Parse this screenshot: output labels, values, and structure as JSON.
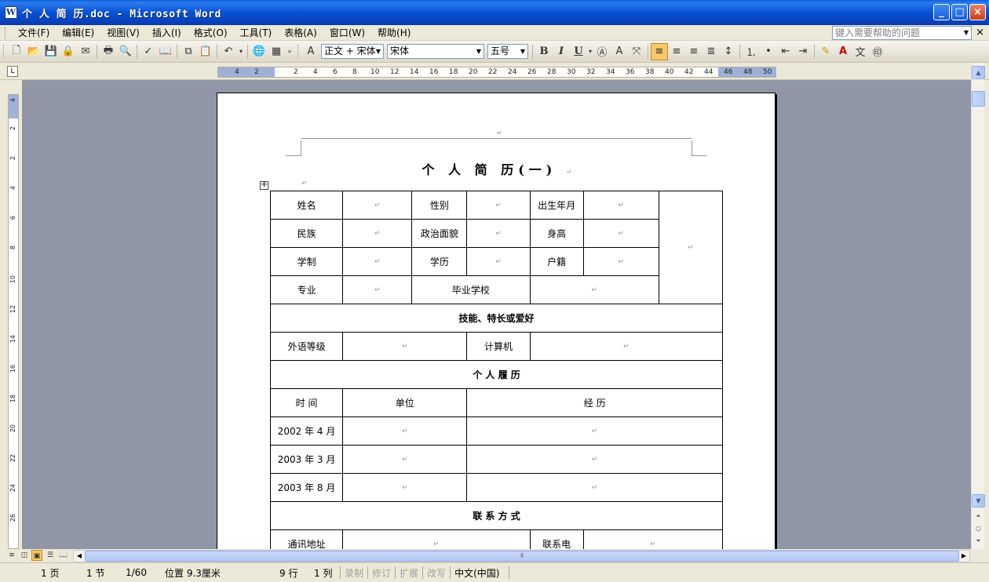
{
  "window": {
    "title": "个 人 简 历.doc - Microsoft Word",
    "minimize": "_",
    "maximize": "□",
    "close": "×"
  },
  "menu": {
    "items": [
      "文件(F)",
      "编辑(E)",
      "视图(V)",
      "插入(I)",
      "格式(O)",
      "工具(T)",
      "表格(A)",
      "窗口(W)",
      "帮助(H)"
    ],
    "help_placeholder": "键入需要帮助的问题",
    "close": "×"
  },
  "toolbar": {
    "style_combo": "正文 + 宋体",
    "font_combo": "宋体",
    "size_combo": "五号",
    "bold": "B",
    "italic": "I",
    "underline": "U"
  },
  "ruler": {
    "ticks": [
      "4",
      "2",
      "2",
      "4",
      "6",
      "8",
      "10",
      "12",
      "14",
      "16",
      "18",
      "20",
      "22",
      "24",
      "26",
      "28",
      "30",
      "32",
      "34",
      "36",
      "38",
      "40",
      "42",
      "44",
      "46",
      "48",
      "50"
    ],
    "vticks": [
      "4",
      "2",
      "2",
      "4",
      "6",
      "8",
      "10",
      "12",
      "14",
      "16",
      "18",
      "20",
      "22",
      "24",
      "26"
    ],
    "tab_selector": "L"
  },
  "document": {
    "header_mark": "↵",
    "title": "个 人 简 历(一)",
    "para_mark": "↵",
    "rows": [
      [
        "姓名",
        "↵",
        "性别",
        "↵",
        "出生年月",
        "↵",
        "↵"
      ],
      [
        "民族",
        "↵",
        "政治面貌",
        "↵",
        "身高",
        "↵"
      ],
      [
        "学制",
        "↵",
        "学历",
        "↵",
        "户籍",
        "↵"
      ],
      [
        "专业",
        "↵",
        "毕业学校",
        "↵"
      ],
      [
        "技能、特长或爱好"
      ],
      [
        "外语等级",
        "↵",
        "计算机",
        "↵"
      ],
      [
        "个 人 履 历"
      ],
      [
        "时 间",
        "单位",
        "经 历"
      ],
      [
        "2002 年 4 月",
        "↵",
        "↵"
      ],
      [
        "2003 年 3 月",
        "↵",
        "↵"
      ],
      [
        "2003 年 8 月",
        "↵",
        "↵"
      ],
      [
        "联 系 方 式"
      ],
      [
        "通讯地址",
        "↵",
        "联系电",
        "↵"
      ]
    ]
  },
  "statusbar": {
    "page": "1 页",
    "section": "1 节",
    "page_of": "1/60",
    "position": "位置 9.3厘米",
    "line": "9 行",
    "column": "1 列",
    "rec": "录制",
    "trk": "修订",
    "ext": "扩展",
    "ovr": "改写",
    "language": "中文(中国)"
  }
}
